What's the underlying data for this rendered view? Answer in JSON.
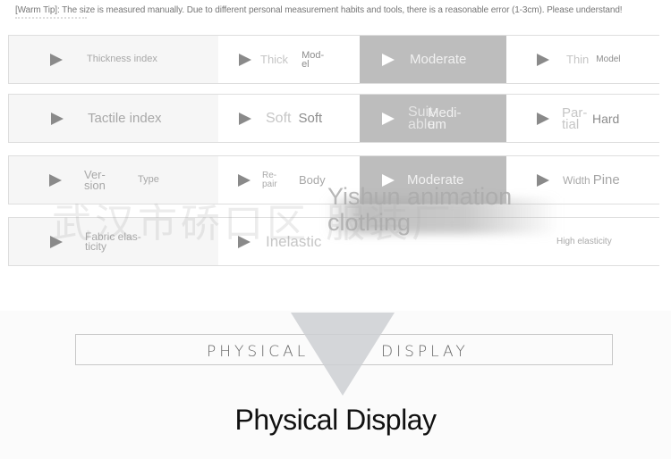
{
  "tip": "[Warm Tip]: The size is measured manually. Due to different personal measurement habits and tools, there is a reasonable error (1-3cm). Please understand!",
  "rows": [
    {
      "label": "Thickness index",
      "col2": {
        "primary": "Thick",
        "secondary": "Mod-el"
      },
      "col3": {
        "primary": "Moderate"
      },
      "col4": {
        "primary": "Thin",
        "secondary": "Model"
      }
    },
    {
      "label": "Tactile index",
      "col2": {
        "primary": "Soft",
        "secondary": "Soft"
      },
      "col3": {
        "primary": "Suit-able",
        "secondary": "Medi-um"
      },
      "col4": {
        "primary": "Par-tial",
        "secondary": "Hard"
      }
    },
    {
      "label_a": "Ver-sion",
      "label_b": "Type",
      "col2": {
        "primary": "Re-pair",
        "secondary": "Body"
      },
      "col3": {
        "primary": "Moderate"
      },
      "col4": {
        "primary": "Width",
        "secondary": "Pine"
      }
    },
    {
      "label": "Fabric elas-ticity",
      "col2": {
        "primary": "Inelastic"
      },
      "col4": {
        "primary": "High elasticity"
      }
    }
  ],
  "watermark": {
    "chinese": "武汉市硚口区  服装厂",
    "english_line1": "Yishun animation",
    "english_line2": "clothing"
  },
  "display": {
    "left": "PHYSICAL",
    "right": "DISPLAY",
    "title": "Physical Display"
  }
}
